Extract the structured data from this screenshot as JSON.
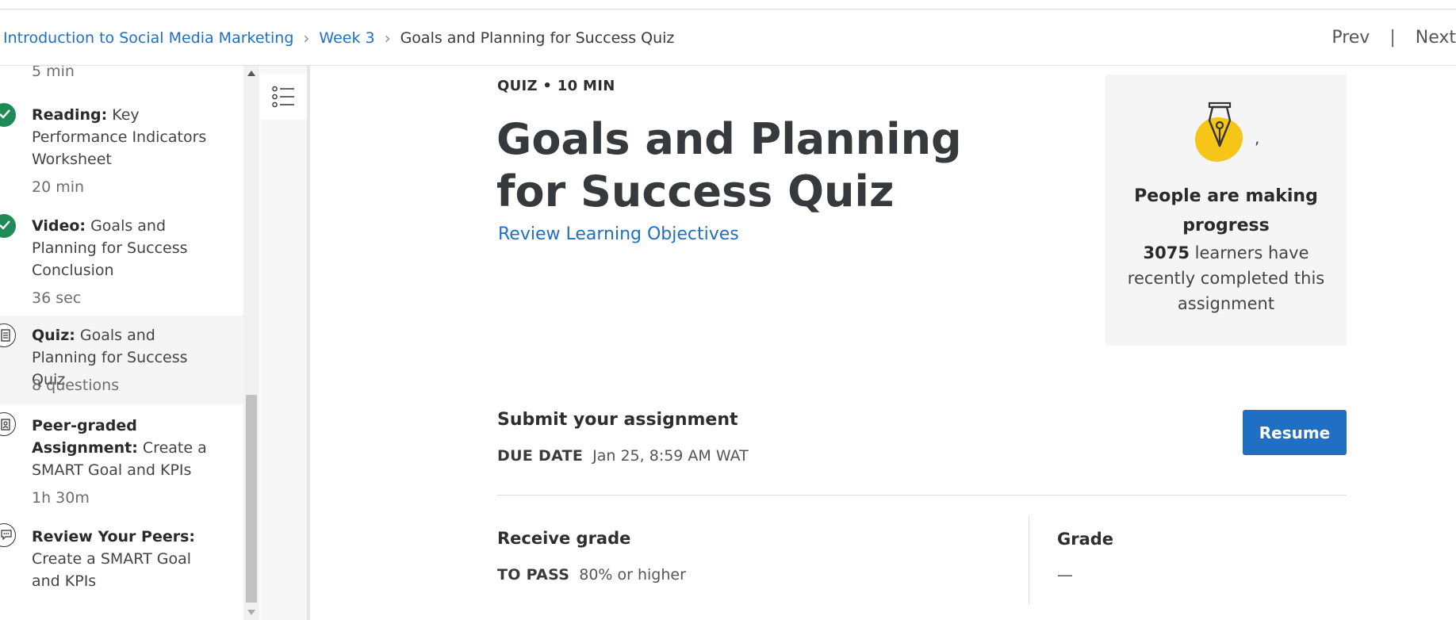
{
  "breadcrumb": {
    "items": [
      "Introduction to Social Media Marketing",
      "Week 3"
    ],
    "current": "Goals and Planning for Success Quiz"
  },
  "nav": {
    "prev": "Prev",
    "separator": "|",
    "next": "Next"
  },
  "sidebar": {
    "top_meta": "5 min",
    "items": [
      {
        "type": "Reading:",
        "title": "Key Performance Indicators Worksheet",
        "meta": "20 min",
        "status": "completed",
        "icon": "check-icon"
      },
      {
        "type": "Video:",
        "title": "Goals and Planning for Success Conclusion",
        "meta": "36 sec",
        "status": "completed",
        "icon": "check-icon"
      },
      {
        "type": "Quiz:",
        "title": "Goals and Planning for Success Quiz",
        "meta": "8 questions",
        "status": "active",
        "icon": "quiz-icon"
      },
      {
        "type": "Peer-graded Assignment:",
        "title": "Create a SMART Goal and KPIs",
        "meta": "1h 30m",
        "status": "pending",
        "icon": "peer-assignment-icon"
      },
      {
        "type": "Review Your Peers:",
        "title": "Create a SMART Goal and KPIs",
        "meta": "",
        "status": "pending",
        "icon": "review-peers-icon"
      }
    ]
  },
  "main": {
    "kicker": "QUIZ • 10 MIN",
    "title": "Goals and Planning for Success Quiz",
    "objectives_link": "Review Learning Objectives",
    "progress_card": {
      "mark": ",",
      "heading": "People are making progress",
      "count": "3075",
      "text": " learners have recently completed this assignment"
    },
    "submit": {
      "title": "Submit your assignment",
      "due_label": "DUE DATE",
      "due_value": "Jan 25, 8:59 AM WAT",
      "button": "Resume"
    },
    "grade_section": {
      "receive_title": "Receive grade",
      "to_pass_label": "TO PASS",
      "to_pass_value": "80% or higher",
      "grade_title": "Grade",
      "grade_value": "—"
    }
  },
  "colors": {
    "link": "#1f6fc5",
    "button": "#1f6fc5",
    "check": "#1e8a55",
    "badge_yellow": "#f5c518",
    "card_bg": "#f5f5f5"
  }
}
